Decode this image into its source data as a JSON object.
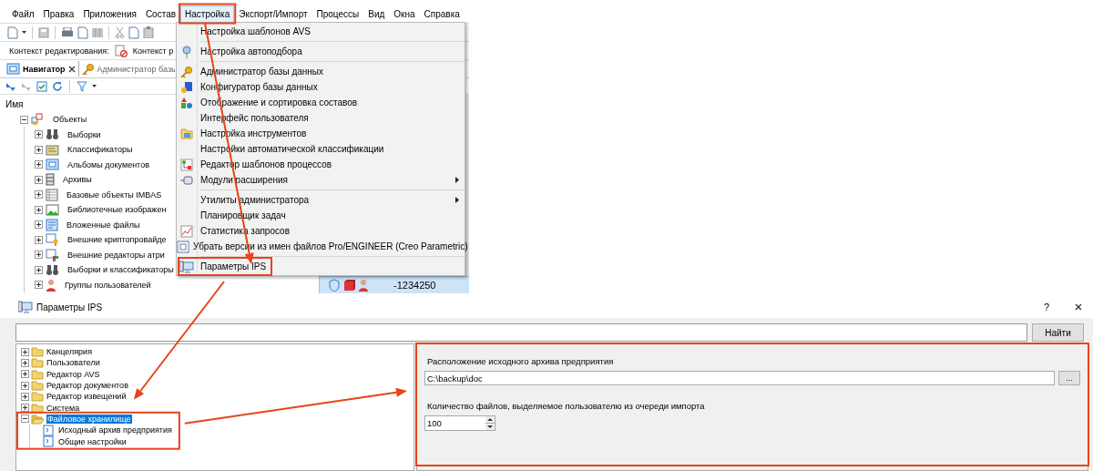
{
  "app": {
    "menu_bar": [
      {
        "label": "Файл",
        "selected": false
      },
      {
        "label": "Правка",
        "selected": false
      },
      {
        "label": "Приложения",
        "selected": false
      },
      {
        "label": "Состав",
        "selected": false
      },
      {
        "label": "Настройка",
        "selected": true
      },
      {
        "label": "Экспорт/Импорт",
        "selected": false
      },
      {
        "label": "Процессы",
        "selected": false
      },
      {
        "label": "Вид",
        "selected": false
      },
      {
        "label": "Окна",
        "selected": false
      },
      {
        "label": "Справка",
        "selected": false
      }
    ],
    "context_bar": [
      "Контекст редактирования:",
      "Контекст р"
    ],
    "tabs": [
      {
        "label": "Навигатор",
        "selected": true
      },
      {
        "label": "Администратор базы",
        "selected": false
      }
    ],
    "tree": {
      "header": "Имя",
      "items": [
        {
          "label": "Объекты",
          "expanded": true,
          "children": [
            {
              "label": "Выборки",
              "expanded": false
            },
            {
              "label": "Классификаторы",
              "expanded": false
            },
            {
              "label": "Альбомы документов",
              "expanded": false
            },
            {
              "label": "Архивы",
              "expanded": false
            },
            {
              "label": "Базовые объекты IMBAS",
              "expanded": false
            },
            {
              "label": "Библиотечные изображен",
              "expanded": false
            },
            {
              "label": "Вложенные файлы",
              "expanded": false
            },
            {
              "label": "Внешние криптопровайде",
              "expanded": false
            },
            {
              "label": "Внешние редакторы атри",
              "expanded": false
            },
            {
              "label": "Выборки и классификаторы",
              "expanded": false
            },
            {
              "label": "Группы пользователей",
              "expanded": false
            }
          ]
        }
      ]
    },
    "grid_row": {
      "value": "-1234250"
    },
    "dropdown_menu": [
      {
        "kind": "item",
        "label": "Настройка шаблонов AVS"
      },
      {
        "kind": "separator"
      },
      {
        "kind": "item",
        "label": "Настройка автоподбора"
      },
      {
        "kind": "separator"
      },
      {
        "kind": "item",
        "label": "Администратор базы данных"
      },
      {
        "kind": "item",
        "label": "Конфигуратор базы данных"
      },
      {
        "kind": "item",
        "label": "Отображение и сортировка составов"
      },
      {
        "kind": "item",
        "label": "Интерфейс пользователя"
      },
      {
        "kind": "item",
        "label": "Настройка инструментов"
      },
      {
        "kind": "item",
        "label": "Настройки автоматической классификации"
      },
      {
        "kind": "item",
        "label": "Редактор шаблонов процессов"
      },
      {
        "kind": "submenu",
        "label": "Модули расширения"
      },
      {
        "kind": "separator"
      },
      {
        "kind": "submenu",
        "label": "Утилиты администратора"
      },
      {
        "kind": "item",
        "label": "Планировщик задач"
      },
      {
        "kind": "item",
        "label": "Статистика запросов"
      },
      {
        "kind": "item",
        "label": "Убрать версии из имен файлов Pro/ENGINEER (Creo Parametric)"
      },
      {
        "kind": "separator"
      },
      {
        "kind": "item",
        "label": "Параметры IPS"
      }
    ]
  },
  "dialog": {
    "title": "Параметры IPS",
    "help": "?",
    "search_button": "Найти",
    "tree": [
      {
        "label": "Канцелярия",
        "expanded": false,
        "selected": false
      },
      {
        "label": "Пользователи",
        "expanded": false,
        "selected": false
      },
      {
        "label": "Редактор AVS",
        "expanded": false,
        "selected": false
      },
      {
        "label": "Редактор документов",
        "expanded": false,
        "selected": false
      },
      {
        "label": "Редактор извещений",
        "expanded": false,
        "selected": false
      },
      {
        "label": "Система",
        "expanded": false,
        "selected": false
      },
      {
        "label": "Файловое хранилище",
        "expanded": true,
        "selected": true,
        "children": [
          {
            "label": "Исходный архив предприятия",
            "selected": false
          },
          {
            "label": "Общие настройки",
            "selected": false
          }
        ]
      }
    ],
    "settings": [
      {
        "kind": "path",
        "label": "Расположение исходного архива предприятия",
        "value": "C:\\backup\\doc",
        "browse": "..."
      },
      {
        "kind": "number",
        "label": "Количество файлов, выделяемое пользователю из очереди импорта",
        "value": "100"
      }
    ]
  }
}
